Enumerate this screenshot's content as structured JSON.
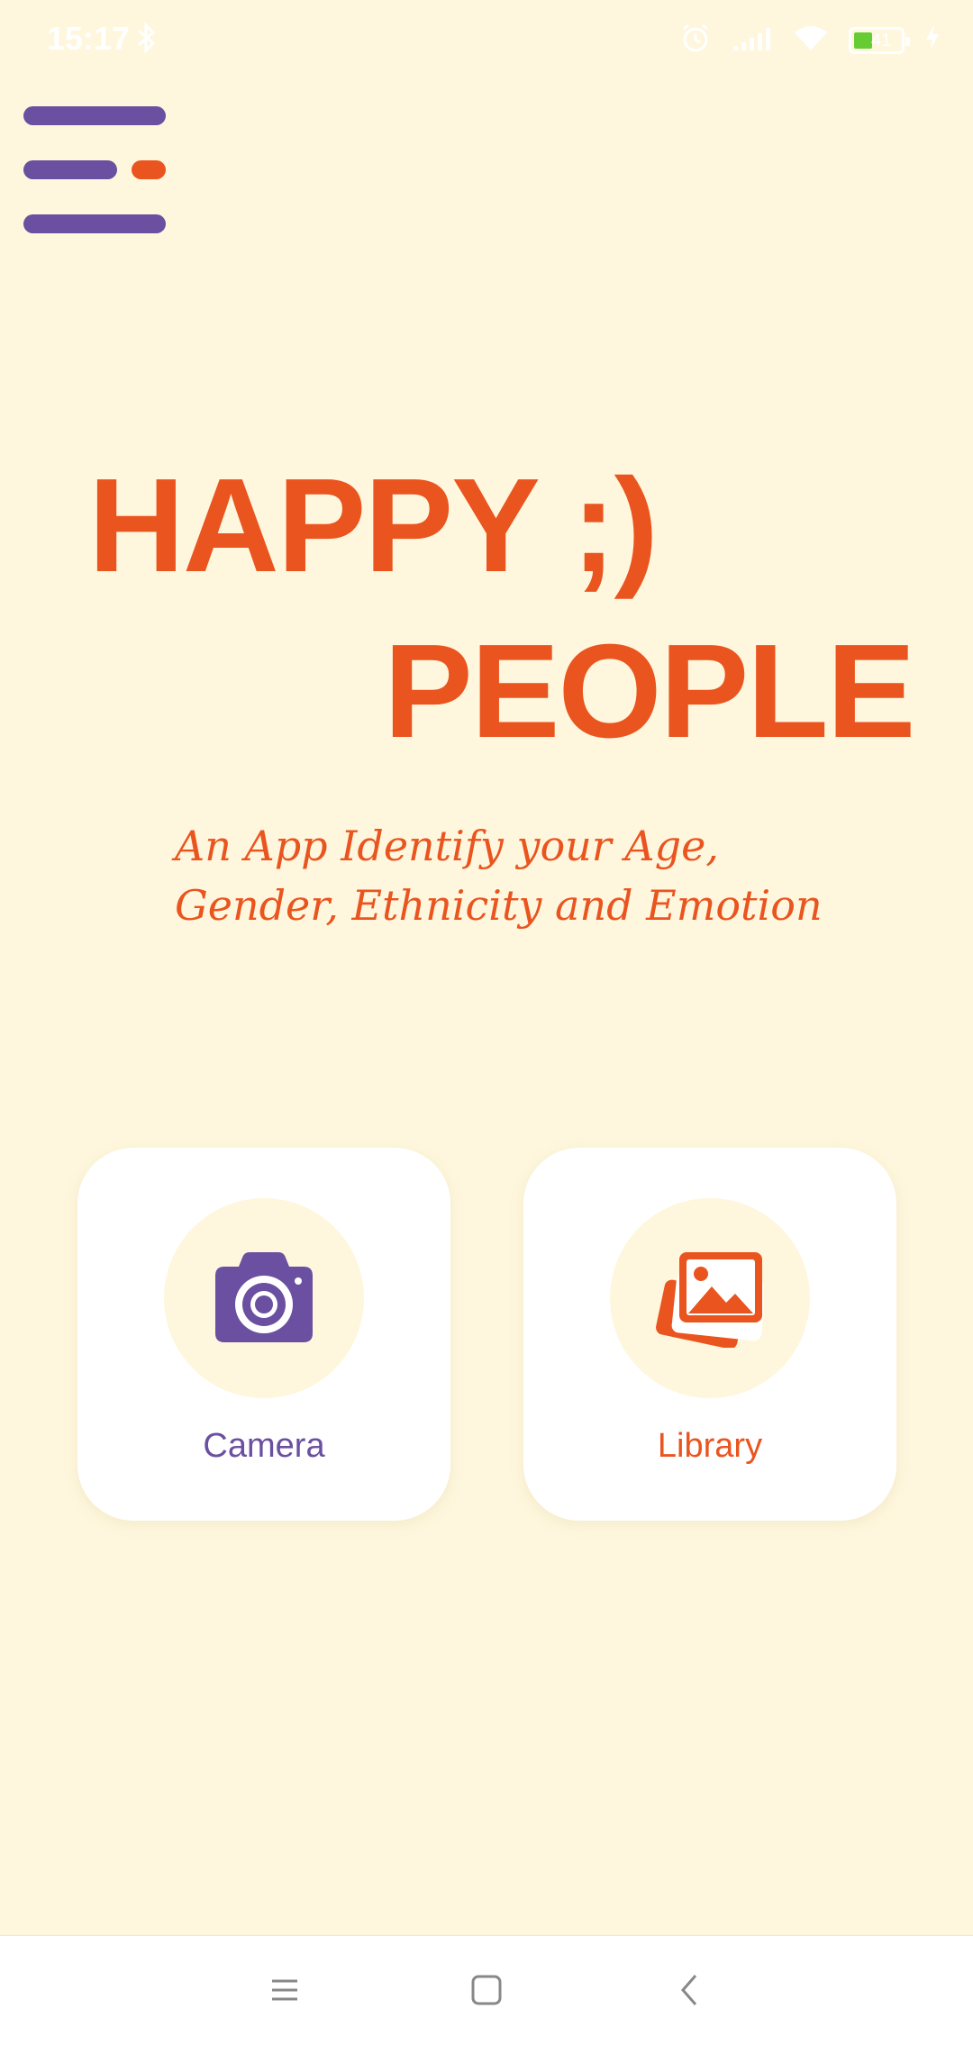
{
  "status_bar": {
    "time": "15:17",
    "battery_level": "41",
    "icons": [
      "bluetooth-icon",
      "alarm-icon",
      "signal-icon",
      "wifi-icon",
      "battery-icon",
      "charging-icon"
    ]
  },
  "menu_button": {
    "icon": "hamburger-menu-icon"
  },
  "hero": {
    "title_line1": "HAPPY ;)",
    "title_line2": "PEOPLE",
    "subtitle": "An App Identify your Age, Gender, Ethnicity and Emotion"
  },
  "actions": {
    "camera": {
      "label": "Camera",
      "icon": "camera-icon"
    },
    "library": {
      "label": "Library",
      "icon": "photo-library-icon"
    }
  },
  "nav_bar": {
    "icons": [
      "recents-icon",
      "home-icon",
      "back-icon"
    ]
  },
  "colors": {
    "background": "#fef7dd",
    "accent_orange": "#ea541f",
    "accent_purple": "#6b4fa0",
    "card": "#ffffff"
  }
}
